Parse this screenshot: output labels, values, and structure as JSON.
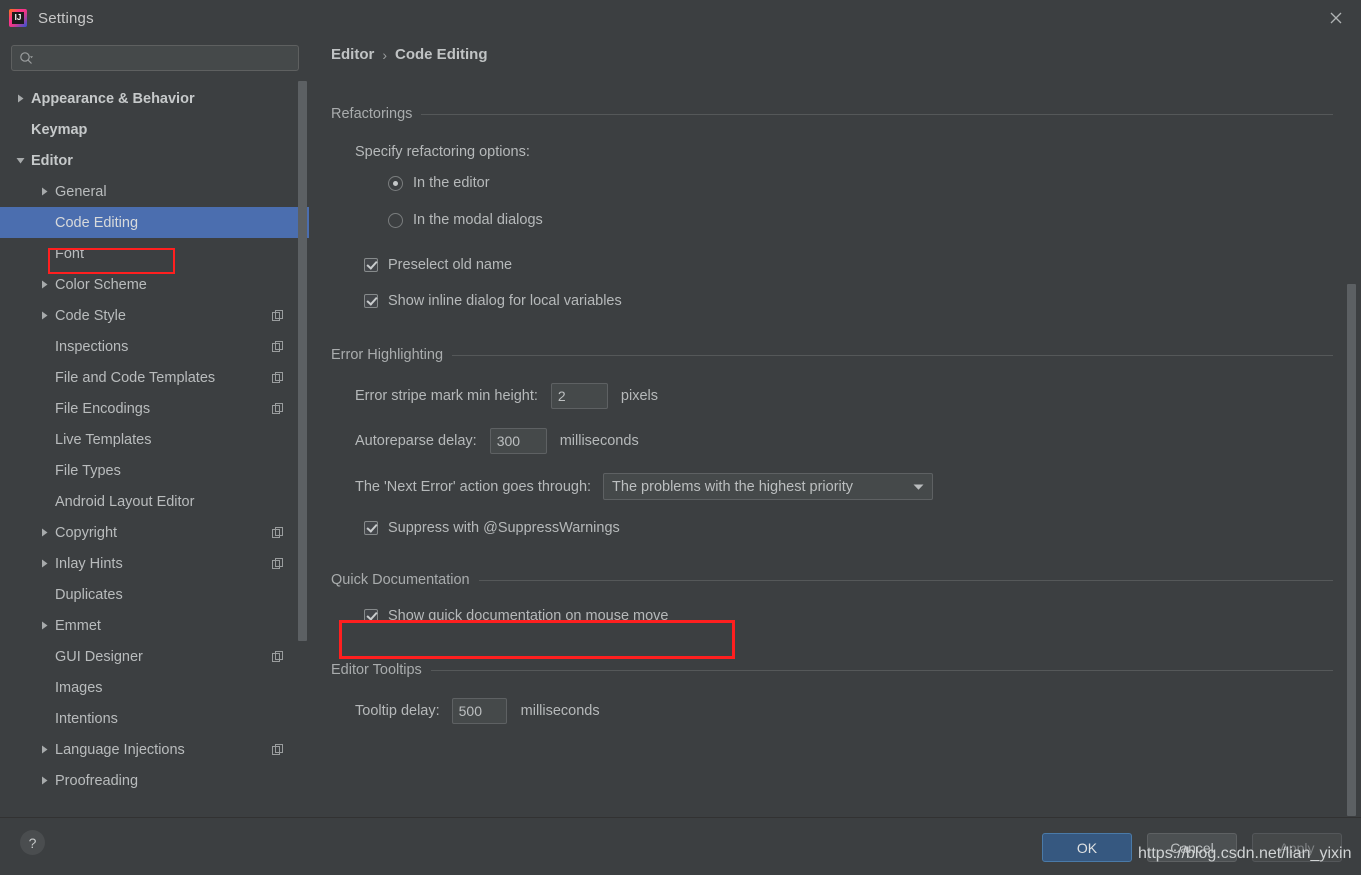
{
  "window": {
    "title": "Settings",
    "logo_icon": "intellij-idea-logo",
    "close_icon": "close-icon"
  },
  "search": {
    "placeholder": "",
    "value": "",
    "icon": "search-icon"
  },
  "sidebar": {
    "items": [
      {
        "label": "Appearance & Behavior",
        "indent": 0,
        "arrow": "collapsed",
        "bold": true,
        "selected": false,
        "badge": false
      },
      {
        "label": "Keymap",
        "indent": 0,
        "arrow": "none",
        "bold": true,
        "selected": false,
        "badge": false
      },
      {
        "label": "Editor",
        "indent": 0,
        "arrow": "expanded",
        "bold": true,
        "selected": false,
        "badge": false
      },
      {
        "label": "General",
        "indent": 1,
        "arrow": "collapsed",
        "bold": false,
        "selected": false,
        "badge": false
      },
      {
        "label": "Code Editing",
        "indent": 1,
        "arrow": "none",
        "bold": false,
        "selected": true,
        "badge": false
      },
      {
        "label": "Font",
        "indent": 1,
        "arrow": "none",
        "bold": false,
        "selected": false,
        "badge": false
      },
      {
        "label": "Color Scheme",
        "indent": 1,
        "arrow": "collapsed",
        "bold": false,
        "selected": false,
        "badge": false
      },
      {
        "label": "Code Style",
        "indent": 1,
        "arrow": "collapsed",
        "bold": false,
        "selected": false,
        "badge": true
      },
      {
        "label": "Inspections",
        "indent": 1,
        "arrow": "none",
        "bold": false,
        "selected": false,
        "badge": true
      },
      {
        "label": "File and Code Templates",
        "indent": 1,
        "arrow": "none",
        "bold": false,
        "selected": false,
        "badge": true
      },
      {
        "label": "File Encodings",
        "indent": 1,
        "arrow": "none",
        "bold": false,
        "selected": false,
        "badge": true
      },
      {
        "label": "Live Templates",
        "indent": 1,
        "arrow": "none",
        "bold": false,
        "selected": false,
        "badge": false
      },
      {
        "label": "File Types",
        "indent": 1,
        "arrow": "none",
        "bold": false,
        "selected": false,
        "badge": false
      },
      {
        "label": "Android Layout Editor",
        "indent": 1,
        "arrow": "none",
        "bold": false,
        "selected": false,
        "badge": false
      },
      {
        "label": "Copyright",
        "indent": 1,
        "arrow": "collapsed",
        "bold": false,
        "selected": false,
        "badge": true
      },
      {
        "label": "Inlay Hints",
        "indent": 1,
        "arrow": "collapsed",
        "bold": false,
        "selected": false,
        "badge": true
      },
      {
        "label": "Duplicates",
        "indent": 1,
        "arrow": "none",
        "bold": false,
        "selected": false,
        "badge": false
      },
      {
        "label": "Emmet",
        "indent": 1,
        "arrow": "collapsed",
        "bold": false,
        "selected": false,
        "badge": false
      },
      {
        "label": "GUI Designer",
        "indent": 1,
        "arrow": "none",
        "bold": false,
        "selected": false,
        "badge": true
      },
      {
        "label": "Images",
        "indent": 1,
        "arrow": "none",
        "bold": false,
        "selected": false,
        "badge": false
      },
      {
        "label": "Intentions",
        "indent": 1,
        "arrow": "none",
        "bold": false,
        "selected": false,
        "badge": false
      },
      {
        "label": "Language Injections",
        "indent": 1,
        "arrow": "collapsed",
        "bold": false,
        "selected": false,
        "badge": true
      },
      {
        "label": "Proofreading",
        "indent": 1,
        "arrow": "collapsed",
        "bold": false,
        "selected": false,
        "badge": false
      }
    ]
  },
  "breadcrumb": {
    "root": "Editor",
    "separator": "›",
    "current": "Code Editing"
  },
  "sections": {
    "refactorings": {
      "title": "Refactorings",
      "specify_label": "Specify refactoring options:",
      "radio_in_editor": "In the editor",
      "radio_in_modal": "In the modal dialogs",
      "radio_selected": "In the editor",
      "cb_preselect": "Preselect old name",
      "cb_preselect_checked": true,
      "cb_inline": "Show inline dialog for local variables",
      "cb_inline_checked": true
    },
    "error_highlighting": {
      "title": "Error Highlighting",
      "stripe_label": "Error stripe mark min height:",
      "stripe_value": "2",
      "stripe_unit": "pixels",
      "autoreparse_label": "Autoreparse delay:",
      "autoreparse_value": "300",
      "autoreparse_unit": "milliseconds",
      "next_error_label": "The 'Next Error' action goes through:",
      "next_error_value": "The problems with the highest priority",
      "cb_suppress": "Suppress with @SuppressWarnings",
      "cb_suppress_checked": true
    },
    "quick_documentation": {
      "title": "Quick Documentation",
      "cb_show": "Show quick documentation on mouse move",
      "cb_show_checked": true,
      "highlight_color": "#ff1f1f"
    },
    "editor_tooltips": {
      "title": "Editor Tooltips",
      "tooltip_label": "Tooltip delay:",
      "tooltip_value": "500",
      "tooltip_unit": "milliseconds"
    }
  },
  "footer": {
    "help_label": "?",
    "ok_label": "OK",
    "cancel_label": "Cancel",
    "apply_label": "Apply"
  },
  "watermark": {
    "text": "https://blog.csdn.net/lian_yixin"
  },
  "colors": {
    "background": "#3c3f41",
    "selection_blue": "#4b6eaf",
    "accent_button": "#365880",
    "annotation_red": "#ff1f1f"
  }
}
